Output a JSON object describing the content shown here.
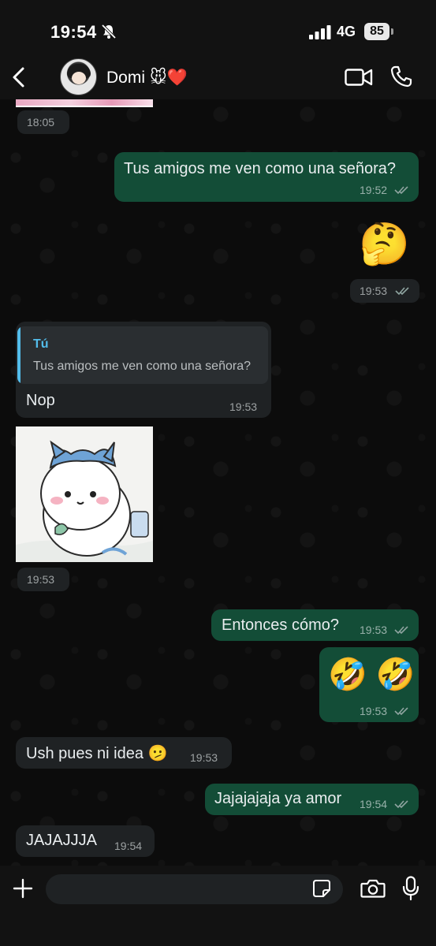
{
  "status_bar": {
    "time": "19:54",
    "network": "4G",
    "battery": "85"
  },
  "header": {
    "contact_name": "Domi 🐭❤️"
  },
  "messages": [
    {
      "id": "m0",
      "direction": "in",
      "type": "sticker",
      "time": "18:05"
    },
    {
      "id": "m1",
      "direction": "out",
      "text": "Tus amigos me ven como una señora?",
      "time": "19:52",
      "status": "read"
    },
    {
      "id": "m2",
      "direction": "out",
      "text": "🤔",
      "time": "19:53",
      "status": "read"
    },
    {
      "id": "m3",
      "direction": "in",
      "reply_to": {
        "author": "Tú",
        "text": "Tus amigos me ven como una señora?"
      },
      "text": "Nop",
      "time": "19:53"
    },
    {
      "id": "m4",
      "direction": "in",
      "type": "sticker",
      "time": "19:53"
    },
    {
      "id": "m5",
      "direction": "out",
      "text": "Entonces cómo?",
      "time": "19:53",
      "status": "read"
    },
    {
      "id": "m6",
      "direction": "out",
      "text": "🤣 🤣",
      "time": "19:53",
      "status": "read"
    },
    {
      "id": "m7",
      "direction": "in",
      "text": "Ush pues ni idea 🫤",
      "time": "19:53"
    },
    {
      "id": "m8",
      "direction": "out",
      "text": "Jajajajaja ya amor",
      "time": "19:54",
      "status": "read"
    },
    {
      "id": "m9",
      "direction": "in",
      "text": "JAJAJJJA",
      "time": "19:54"
    }
  ],
  "input": {
    "placeholder": ""
  },
  "colors": {
    "outgoing_bubble": "#134d37",
    "incoming_bubble": "#1f2224",
    "reply_accent": "#53bdeb",
    "read_ticks": "#8fa4a0"
  }
}
